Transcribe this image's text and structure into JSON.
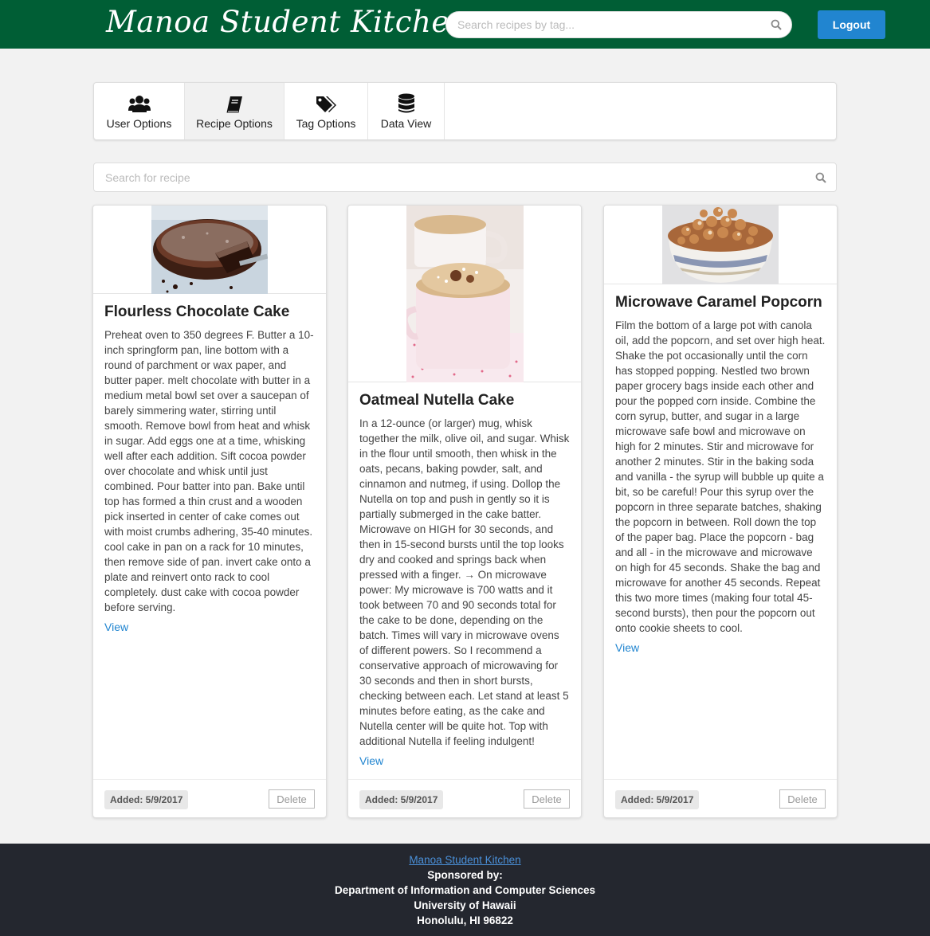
{
  "header": {
    "brand": "Manoa Student Kitchen",
    "search_placeholder": "Search recipes by tag...",
    "logout_label": "Logout"
  },
  "tabs": [
    {
      "label": "User Options",
      "icon": "users-icon",
      "active": false
    },
    {
      "label": "Recipe Options",
      "icon": "book-icon",
      "active": true
    },
    {
      "label": "Tag Options",
      "icon": "tags-icon",
      "active": false
    },
    {
      "label": "Data View",
      "icon": "database-icon",
      "active": false
    }
  ],
  "recipe_search": {
    "placeholder": "Search for recipe"
  },
  "recipes": [
    {
      "title": "Flourless Chocolate Cake",
      "description": "Preheat oven to 350 degrees F. Butter a 10-inch springform pan, line bottom with a round of parchment or wax paper, and butter paper. melt chocolate with butter in a medium metal bowl set over a saucepan of barely simmering water, stirring until smooth. Remove bowl from heat and whisk in sugar. Add eggs one at a time, whisking well after each addition. Sift cocoa powder over chocolate and whisk until just combined. Pour batter into pan. Bake until top has formed a thin crust and a wooden pick inserted in center of cake comes out with moist crumbs adhering, 35-40 minutes. cool cake in pan on a rack for 10 minutes, then remove side of pan. invert cake onto a plate and reinvert onto rack to cool completely. dust cake with cocoa powder before serving.",
      "view_label": "View",
      "added": "Added: 5/9/2017",
      "delete_label": "Delete"
    },
    {
      "title": "Oatmeal Nutella Cake",
      "description": "In a 12-ounce (or larger) mug, whisk together the milk, olive oil, and sugar. Whisk in the flour until smooth, then whisk in the oats, pecans, baking powder, salt, and cinnamon and nutmeg, if using. Dollop the Nutella on top and push in gently so it is partially submerged in the cake batter. Microwave on HIGH for 30 seconds, and then in 15-second bursts until the top looks dry and cooked and springs back when pressed with a finger. → On microwave power: My microwave is 700 watts and it took between 70 and 90 seconds total for the cake to be done, depending on the batch. Times will vary in microwave ovens of different powers. So I recommend a conservative approach of microwaving for 30 seconds and then in short bursts, checking between each. Let stand at least 5 minutes before eating, as the cake and Nutella center will be quite hot. Top with additional Nutella if feeling indulgent!",
      "view_label": "View",
      "added": "Added: 5/9/2017",
      "delete_label": "Delete"
    },
    {
      "title": "Microwave Caramel Popcorn",
      "description": "Film the bottom of a large pot with canola oil, add the popcorn, and set over high heat. Shake the pot occasionally until the corn has stopped popping. Nestled two brown paper grocery bags inside each other and pour the popped corn inside. Combine the corn syrup, butter, and sugar in a large microwave safe bowl and microwave on high for 2 minutes. Stir and microwave for another 2 minutes. Stir in the baking soda and vanilla - the syrup will bubble up quite a bit, so be careful! Pour this syrup over the popcorn in three separate batches, shaking the popcorn in between. Roll down the top of the paper bag. Place the popcorn - bag and all - in the microwave and microwave on high for 45 seconds. Shake the bag and microwave for another 45 seconds. Repeat this two more times (making four total 45-second bursts), then pour the popcorn out onto cookie sheets to cool.",
      "view_label": "View",
      "added": "Added: 5/9/2017",
      "delete_label": "Delete"
    }
  ],
  "footer": {
    "link": "Manoa Student Kitchen",
    "line1": "Sponsored by:",
    "line2": "Department of Information and Computer Sciences",
    "line3": "University of Hawaii",
    "line4": "Honolulu, HI 96822"
  },
  "colors": {
    "header_bg": "#005e35",
    "logout_bg": "#2185d0",
    "link": "#2185d0",
    "footer_bg": "#24272f"
  }
}
